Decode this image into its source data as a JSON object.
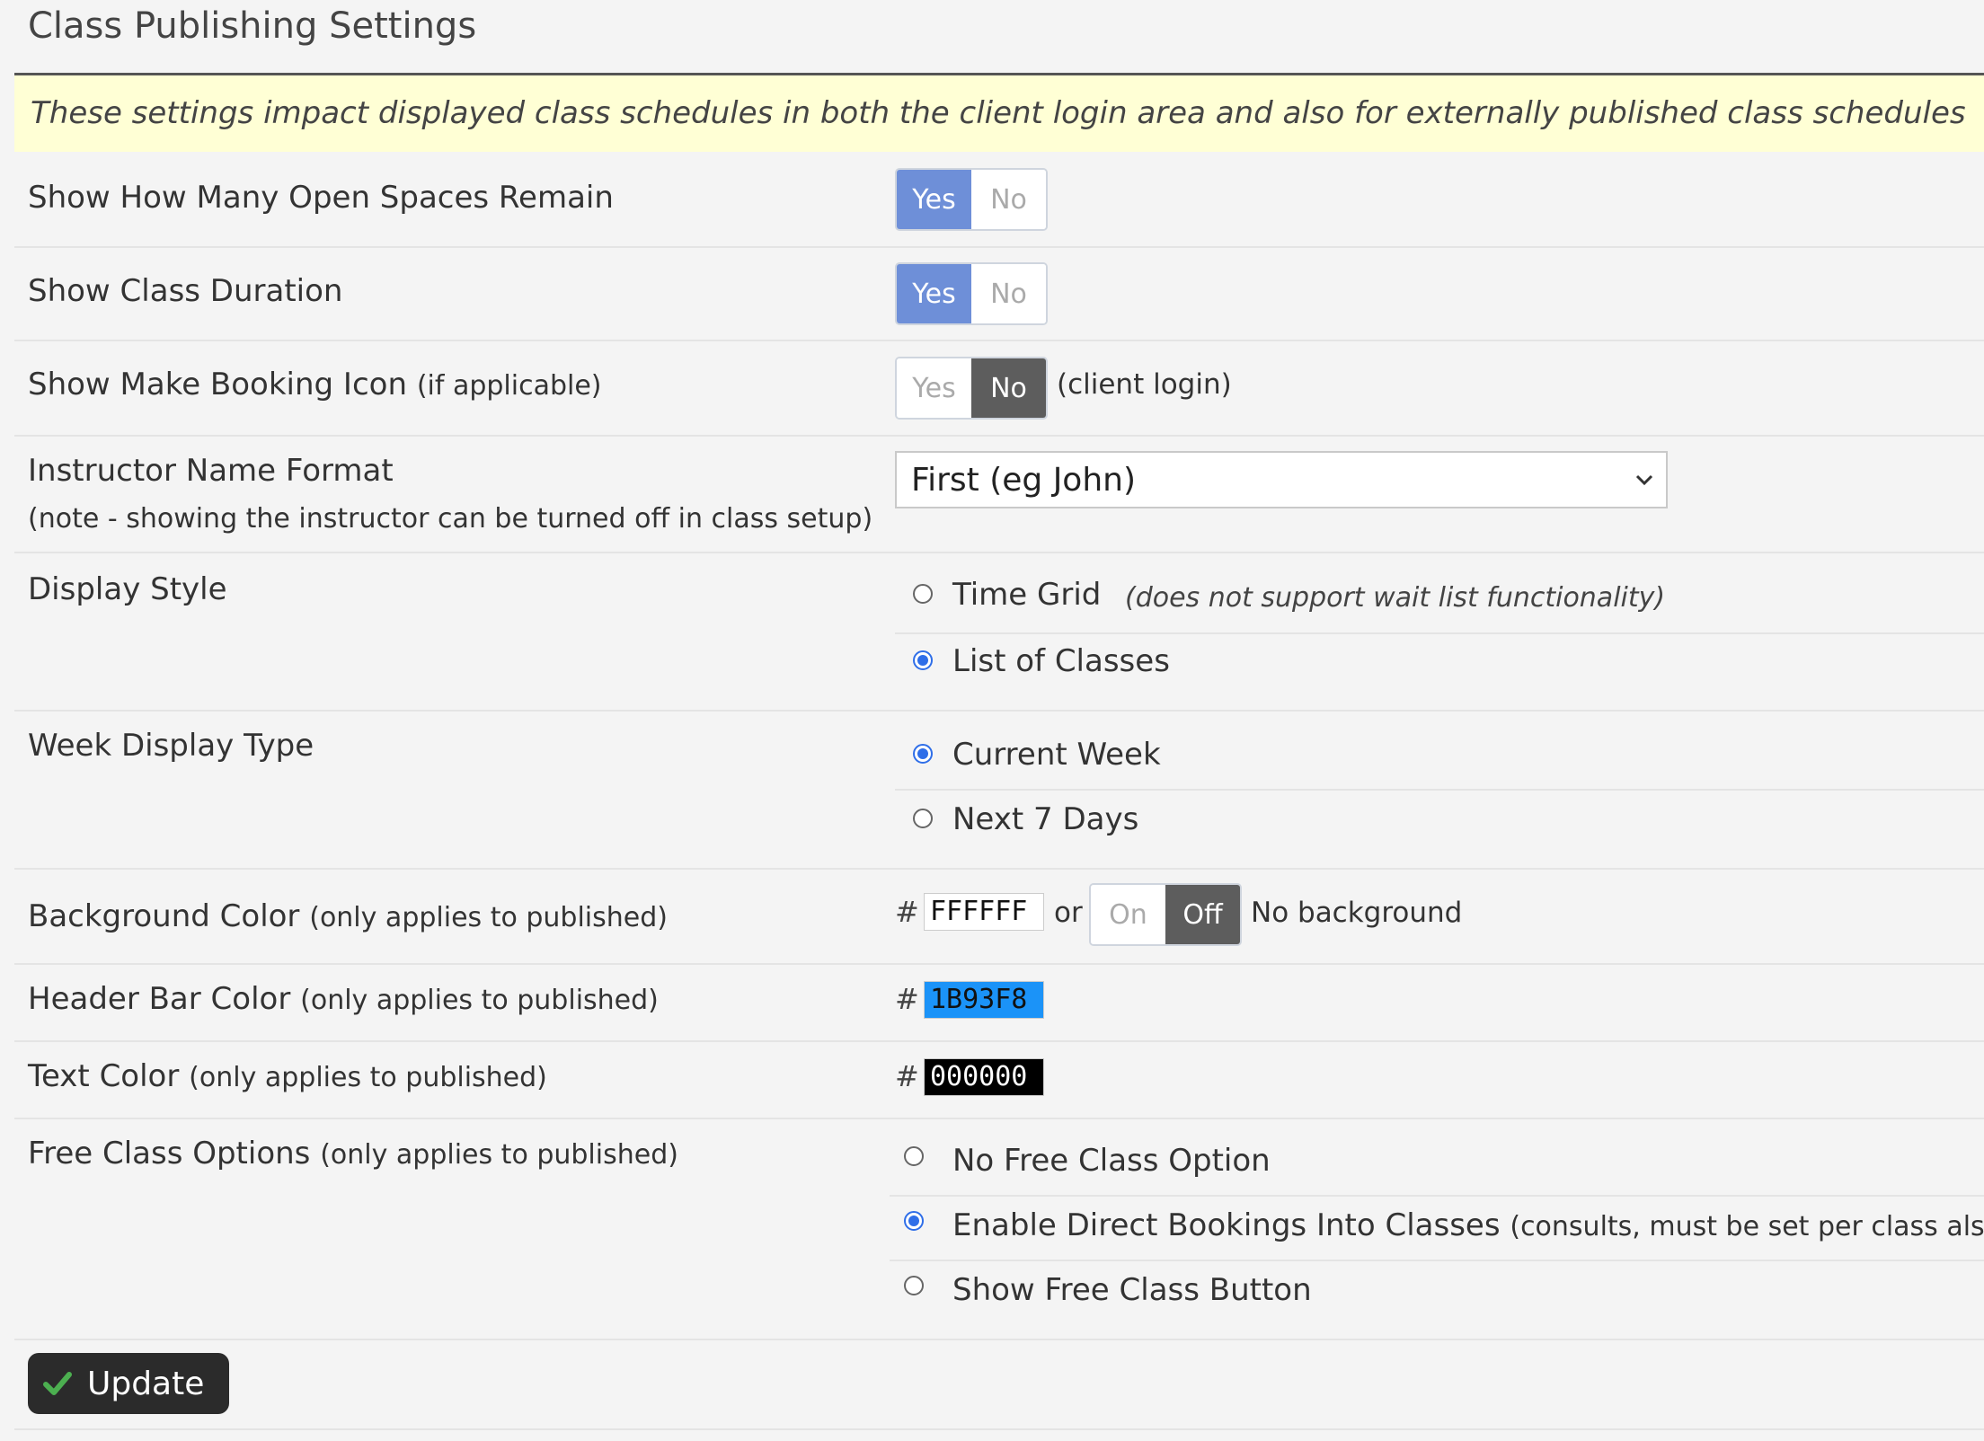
{
  "page": {
    "title": "Class Publishing Settings",
    "notice": "These settings impact displayed class schedules in both the client login area and also for externally published class schedules"
  },
  "settings": {
    "open_spaces": {
      "label": "Show How Many Open Spaces Remain",
      "yes": "Yes",
      "no": "No",
      "selected": "Yes"
    },
    "class_duration": {
      "label": "Show Class Duration",
      "yes": "Yes",
      "no": "No",
      "selected": "Yes"
    },
    "booking_icon": {
      "label": "Show Make Booking Icon",
      "label_sub": "(if applicable)",
      "yes": "Yes",
      "no": "No",
      "selected": "No",
      "suffix": "(client login)"
    },
    "instructor": {
      "label": "Instructor Name Format",
      "note": "(note - showing the instructor can be turned off in class setup)",
      "selected": "First (eg John)"
    },
    "display_style": {
      "label": "Display Style",
      "options": [
        {
          "label": "Time Grid",
          "note": "(does not support wait list functionality)",
          "checked": false
        },
        {
          "label": "List of Classes",
          "checked": true
        }
      ]
    },
    "week_display": {
      "label": "Week Display Type",
      "options": [
        {
          "label": "Current Week",
          "checked": true
        },
        {
          "label": "Next 7 Days",
          "checked": false
        }
      ]
    },
    "background_color": {
      "label": "Background Color",
      "label_sub": "(only applies to published)",
      "hash": "#",
      "value": "FFFFFF",
      "or": "or",
      "on": "On",
      "off": "Off",
      "selected": "Off",
      "suffix": "No background"
    },
    "header_bar_color": {
      "label": "Header Bar Color",
      "label_sub": "(only applies to published)",
      "hash": "#",
      "value": "1B93F8",
      "color": "#1b93f8"
    },
    "text_color": {
      "label": "Text Color",
      "label_sub": "(only applies to published)",
      "hash": "#",
      "value": "000000",
      "color": "#000000"
    },
    "free_class": {
      "label": "Free Class Options",
      "label_sub": "(only applies to published)",
      "options": [
        {
          "label": "No Free Class Option",
          "checked": false
        },
        {
          "label": "Enable Direct Bookings Into Classes",
          "sub": "(consults, must be set per class also)",
          "checked": true
        },
        {
          "label": "Show Free Class Button",
          "checked": false
        }
      ]
    }
  },
  "actions": {
    "update_label": "Update"
  },
  "colors": {
    "toggle_active_blue": "#6e8fd8",
    "toggle_active_dark": "#5d5d5d",
    "radio_blue": "#2f6ee8",
    "check_green": "#4caf50"
  }
}
